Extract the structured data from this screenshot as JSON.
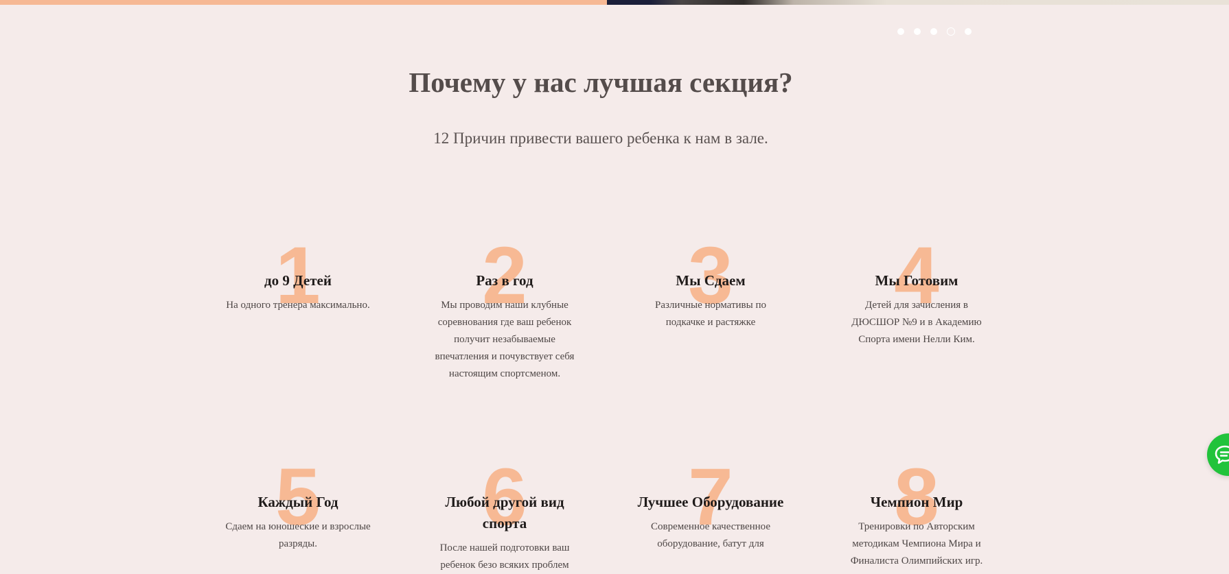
{
  "colors": {
    "background": "#f5ebea",
    "accent_number": "#f7b994",
    "hero_strip": "#f6b894",
    "chat_green": "#21c33b"
  },
  "slider": {
    "dots": 5,
    "active_index": 3
  },
  "section": {
    "title": "Почему у нас лучшая секция?",
    "subtitle": "12 Причин привести вашего ребенка к нам в зале."
  },
  "features": [
    {
      "number": "1",
      "title": "до 9 Детей",
      "desc": "На одного тренера максимально."
    },
    {
      "number": "2",
      "title": "Раз в год",
      "desc": "Мы проводим наши клубные соревнования где ваш ребенок получит незабываемые впечатления и почувствует себя настоящим спортсменом."
    },
    {
      "number": "3",
      "title": "Мы Сдаем",
      "desc": "Различные нормативы по подкачке и растяжке"
    },
    {
      "number": "4",
      "title": "Мы Готовим",
      "desc": "Детей для зачисления в ДЮСШОР №9 и в Академию Спорта имени Нелли Ким."
    },
    {
      "number": "5",
      "title": "Каждый Год",
      "desc": "Сдаем на юношеские и взрослые разряды."
    },
    {
      "number": "6",
      "title": "Любой другой вид спорта",
      "desc": "После нашей подготовки ваш ребенок безо всяких проблем"
    },
    {
      "number": "7",
      "title": "Лучшее Оборудование",
      "desc": "Современное качественное оборудование, батут для"
    },
    {
      "number": "8",
      "title": "Чемпион Мир",
      "desc": "Тренировки по Авторским методикам Чемпиона Мира и Финалиста Олимпийских игр."
    }
  ],
  "chat": {
    "icon": "chat-bubble-icon"
  }
}
